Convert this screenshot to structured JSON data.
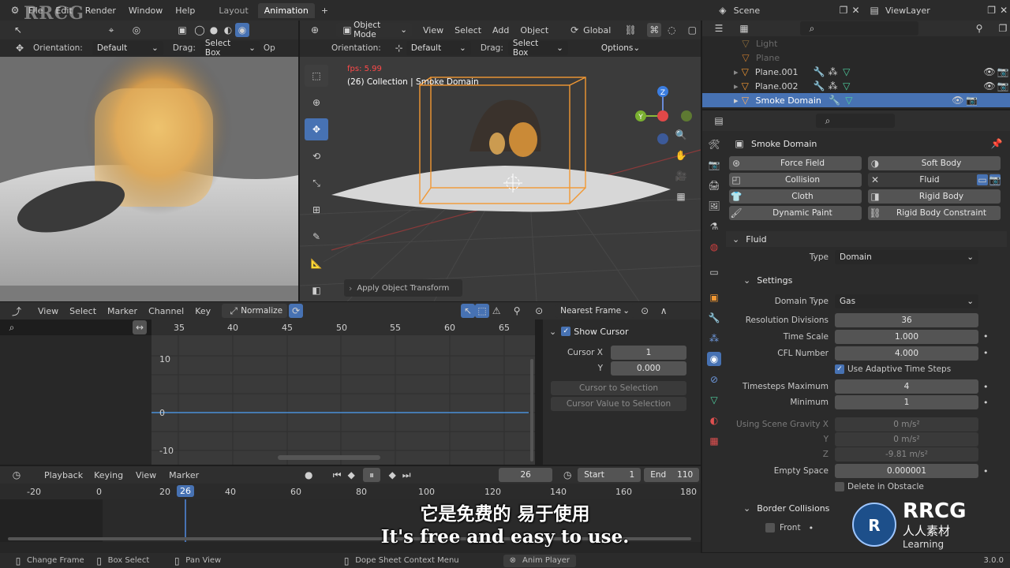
{
  "watermark": "RRCG",
  "topbar": {
    "menus": [
      "File",
      "Edit",
      "Render",
      "Window",
      "Help"
    ],
    "workspaces": [
      "Layout",
      "Animation"
    ],
    "active_workspace": "Animation",
    "add_tab": "+",
    "scene_label": "Scene",
    "viewlayer_label": "ViewLayer"
  },
  "left_viewport": {
    "orientation_label": "Orientation:",
    "orientation_value": "Default",
    "drag_label": "Drag:",
    "drag_value": "Select Box",
    "extra_label": "Op"
  },
  "main_viewport": {
    "mode": "Object Mode",
    "menus": [
      "View",
      "Select",
      "Add",
      "Object"
    ],
    "transform": "Global",
    "orientation_label": "Orientation:",
    "orientation_value": "Default",
    "drag_label": "Drag:",
    "drag_value": "Select Box",
    "options": "Options",
    "fps": "fps: 5.99",
    "info": "(26) Collection | Smoke Domain",
    "apply_panel": "Apply Object Transform"
  },
  "outliner": {
    "items": [
      {
        "name": "Light"
      },
      {
        "name": "Plane"
      },
      {
        "name": "Plane.001"
      },
      {
        "name": "Plane.002"
      },
      {
        "name": "Smoke Domain",
        "selected": true
      }
    ]
  },
  "properties": {
    "object_name": "Smoke Domain",
    "physics_buttons": [
      [
        "Force Field",
        "Soft Body"
      ],
      [
        "Collision",
        "Fluid"
      ],
      [
        "Cloth",
        "Rigid Body"
      ],
      [
        "Dynamic Paint",
        "Rigid Body Constraint"
      ]
    ],
    "fluid_header": "Fluid",
    "type_label": "Type",
    "type_value": "Domain",
    "settings_header": "Settings",
    "domain_type_label": "Domain Type",
    "domain_type_value": "Gas",
    "rows": [
      {
        "label": "Resolution Divisions",
        "value": "36"
      },
      {
        "label": "Time Scale",
        "value": "1.000"
      },
      {
        "label": "CFL Number",
        "value": "4.000"
      }
    ],
    "adaptive_label": "Use Adaptive Time Steps",
    "timesteps_max_label": "Timesteps Maximum",
    "timesteps_max_value": "4",
    "minimum_label": "Minimum",
    "minimum_value": "1",
    "gravity_label": "Using Scene Gravity X",
    "gravity_x": "0 m/s²",
    "gravity_y_label": "Y",
    "gravity_y": "0 m/s²",
    "gravity_z_label": "Z",
    "gravity_z": "-9.81 m/s²",
    "empty_space_label": "Empty Space",
    "empty_space_value": "0.000001",
    "delete_obstacle_label": "Delete in Obstacle",
    "border_collisions_header": "Border Collisions",
    "front_label": "Front"
  },
  "graph_editor": {
    "menus": [
      "View",
      "Select",
      "Marker",
      "Channel",
      "Key"
    ],
    "normalize": "Normalize",
    "nearest_frame": "Nearest Frame",
    "ruler": [
      "35",
      "40",
      "45",
      "50",
      "55",
      "60",
      "65"
    ],
    "yticks": [
      "10",
      "0",
      "-10"
    ],
    "show_cursor": "Show Cursor",
    "cursor_x_label": "Cursor X",
    "cursor_x_value": "1",
    "cursor_y_label": "Y",
    "cursor_y_value": "0.000",
    "cursor_to_selection": "Cursor to Selection",
    "cursor_value_to_selection": "Cursor Value to Selection"
  },
  "timeline": {
    "menus": [
      "Playback",
      "Keying",
      "View",
      "Marker"
    ],
    "current_frame": "26",
    "start_label": "Start",
    "start_value": "1",
    "end_label": "End",
    "end_value": "110",
    "ruler": [
      "-20",
      "0",
      "20",
      "40",
      "60",
      "80",
      "100",
      "120",
      "140",
      "160",
      "180"
    ],
    "playhead": "26"
  },
  "statusbar": {
    "items": [
      "Change Frame",
      "Box Select",
      "Pan View",
      "Dope Sheet Context Menu",
      "Anim Player"
    ],
    "version": "3.0.0"
  },
  "subtitles": {
    "zh": "它是免费的 易于使用",
    "en": "It's free and easy to use."
  },
  "corner_brand": {
    "name": "RRCG",
    "cn": "人人素材",
    "learning": "Learning"
  },
  "colors": {
    "accent_blue": "#4772b3",
    "selection_orange": "#f29833",
    "fps_red": "#ff4a4a"
  }
}
